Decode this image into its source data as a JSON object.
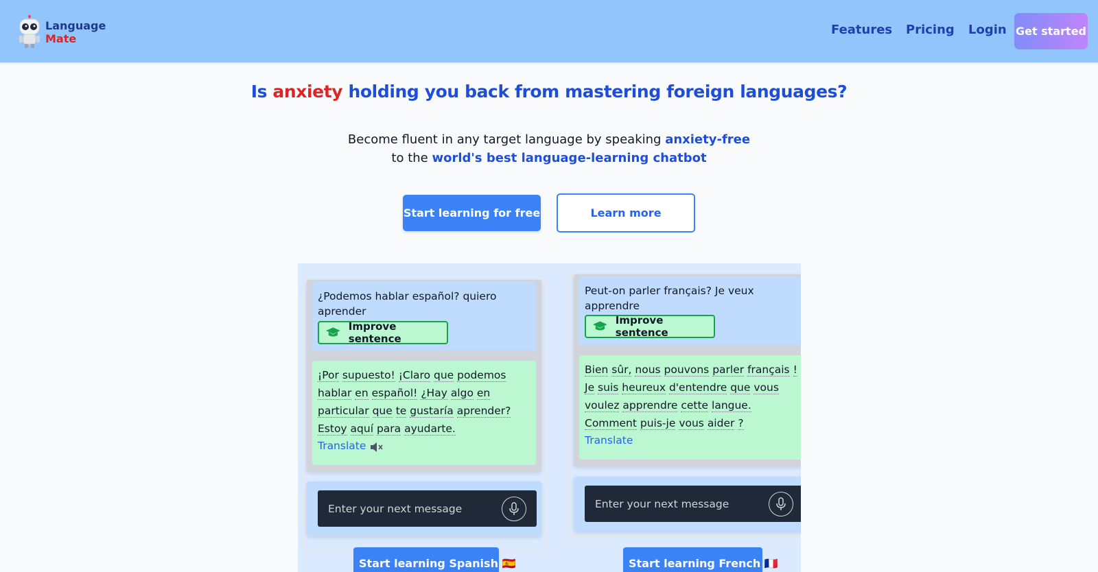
{
  "brand": {
    "line1": "Language",
    "line2": "Mate"
  },
  "nav": {
    "features": "Features",
    "pricing": "Pricing",
    "login": "Login",
    "cta": "Get started"
  },
  "hero": {
    "headline_pre": "Is ",
    "headline_highlight": "anxiety",
    "headline_post": " holding you back from mastering foreign languages?",
    "sub_line1_pre": "Become fluent in any target language by speaking ",
    "sub_line1_highlight": "anxiety-free",
    "sub_line2_pre": "to the ",
    "sub_line2_highlight": "world's best language-learning chatbot",
    "primary_button": "Start learning for free",
    "secondary_button": "Learn more"
  },
  "demo": {
    "spanish": {
      "user_message": "¿Podemos hablar español? quiero aprender",
      "improve_label": "Improve sentence",
      "bot_words": [
        "¡Por",
        "supuesto!",
        "¡Claro",
        "que",
        "podemos",
        "hablar",
        "en",
        "español!",
        "¿Hay",
        "algo",
        "en",
        "particular",
        "que",
        "te",
        "gustaría",
        "aprender?",
        "Estoy",
        "aquí",
        "para",
        "ayudarte."
      ],
      "translate": "Translate",
      "input_placeholder": "Enter your next message",
      "cta": "Start learning Spanish 🇪🇸"
    },
    "french": {
      "user_message": "Peut-on parler français? Je veux apprendre",
      "improve_label": "Improve sentence",
      "bot_words": [
        "Bien",
        "sûr,",
        "nous",
        "pouvons",
        "parler",
        "français",
        "!",
        "Je",
        "suis",
        "heureux",
        "d'entendre",
        "que",
        "vous",
        "voulez",
        "apprendre",
        "cette",
        "langue.",
        "Comment",
        "puis-je",
        "vous",
        "aider",
        "?"
      ],
      "translate": "Translate",
      "input_placeholder": "Enter your next message",
      "cta": "Start learning French 🇫🇷"
    }
  },
  "colors": {
    "header_bg": "#93c5fd",
    "brand_blue": "#1d4ed8",
    "accent_red": "#dc2626",
    "button_blue": "#3b82f6",
    "user_bubble": "#bfdbfe",
    "bot_bubble": "#bbf7d0",
    "improve_border": "#16a34a"
  },
  "icons": [
    "robot-logo-icon",
    "graduation-cap-icon",
    "mute-speaker-icon",
    "microphone-icon"
  ]
}
